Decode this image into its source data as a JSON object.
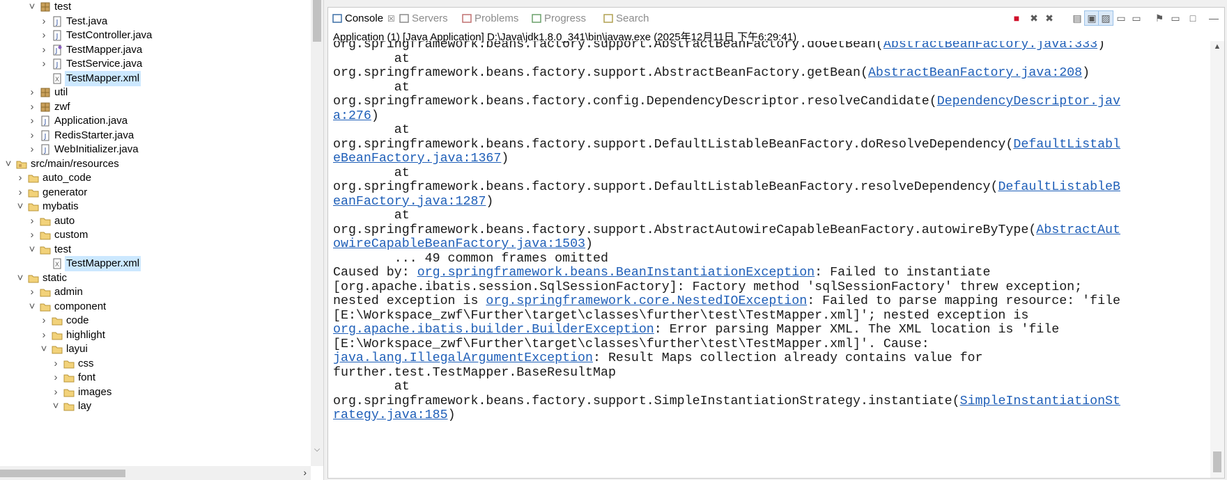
{
  "explorer": {
    "rows": [
      {
        "label": "test",
        "indent": 2,
        "chevron": "expanded",
        "icon": "package-icon"
      },
      {
        "label": "Test.java",
        "indent": 3,
        "chevron": "collapsed",
        "icon": "java-file-icon"
      },
      {
        "label": "TestController.java",
        "indent": 3,
        "chevron": "collapsed",
        "icon": "java-file-icon"
      },
      {
        "label": "TestMapper.java",
        "indent": 3,
        "chevron": "collapsed",
        "icon": "java-interface-file-icon"
      },
      {
        "label": "TestService.java",
        "indent": 3,
        "chevron": "collapsed",
        "icon": "java-file-icon"
      },
      {
        "label": "TestMapper.xml",
        "indent": 3,
        "chevron": "none",
        "icon": "xml-file-icon",
        "selected": true
      },
      {
        "label": "util",
        "indent": 2,
        "chevron": "collapsed",
        "icon": "package-icon"
      },
      {
        "label": "zwf",
        "indent": 2,
        "chevron": "collapsed",
        "icon": "package-icon"
      },
      {
        "label": "Application.java",
        "indent": 2,
        "chevron": "collapsed",
        "icon": "java-file-icon"
      },
      {
        "label": "RedisStarter.java",
        "indent": 2,
        "chevron": "collapsed",
        "icon": "java-file-icon"
      },
      {
        "label": "WebInitializer.java",
        "indent": 2,
        "chevron": "collapsed",
        "icon": "java-file-icon"
      },
      {
        "label": "src/main/resources",
        "indent": 0,
        "chevron": "expanded",
        "icon": "source-folder-icon"
      },
      {
        "label": "auto_code",
        "indent": 1,
        "chevron": "collapsed",
        "icon": "folder-icon"
      },
      {
        "label": "generator",
        "indent": 1,
        "chevron": "collapsed",
        "icon": "folder-icon"
      },
      {
        "label": "mybatis",
        "indent": 1,
        "chevron": "expanded",
        "icon": "folder-icon"
      },
      {
        "label": "auto",
        "indent": 2,
        "chevron": "collapsed",
        "icon": "folder-icon"
      },
      {
        "label": "custom",
        "indent": 2,
        "chevron": "collapsed",
        "icon": "folder-icon"
      },
      {
        "label": "test",
        "indent": 2,
        "chevron": "expanded",
        "icon": "folder-icon"
      },
      {
        "label": "TestMapper.xml",
        "indent": 3,
        "chevron": "none",
        "icon": "xml-file-icon",
        "selected": true
      },
      {
        "label": "static",
        "indent": 1,
        "chevron": "expanded",
        "icon": "folder-icon"
      },
      {
        "label": "admin",
        "indent": 2,
        "chevron": "collapsed",
        "icon": "folder-icon"
      },
      {
        "label": "component",
        "indent": 2,
        "chevron": "expanded",
        "icon": "folder-icon"
      },
      {
        "label": "code",
        "indent": 3,
        "chevron": "collapsed",
        "icon": "folder-icon"
      },
      {
        "label": "highlight",
        "indent": 3,
        "chevron": "collapsed",
        "icon": "folder-icon"
      },
      {
        "label": "layui",
        "indent": 3,
        "chevron": "expanded",
        "icon": "folder-icon"
      },
      {
        "label": "css",
        "indent": 4,
        "chevron": "collapsed",
        "icon": "folder-icon"
      },
      {
        "label": "font",
        "indent": 4,
        "chevron": "collapsed",
        "icon": "folder-icon"
      },
      {
        "label": "images",
        "indent": 4,
        "chevron": "collapsed",
        "icon": "folder-icon"
      },
      {
        "label": "lay",
        "indent": 4,
        "chevron": "expanded",
        "icon": "folder-icon"
      }
    ]
  },
  "console": {
    "tabs": [
      {
        "label": "Console",
        "icon": "console-icon",
        "active": true
      },
      {
        "label": "Servers",
        "icon": "servers-icon",
        "active": false
      },
      {
        "label": "Problems",
        "icon": "problems-icon",
        "active": false
      },
      {
        "label": "Progress",
        "icon": "progress-icon",
        "active": false
      },
      {
        "label": "Search",
        "icon": "search-icon",
        "active": false
      }
    ],
    "toolbar": [
      "terminate-icon",
      "remove-launch-icon",
      "remove-all-launches-icon",
      "clear-console-icon",
      "scroll-lock-icon",
      "word-wrap-icon",
      "show-on-stdout-icon",
      "show-on-stderr-icon",
      "pin-console-icon",
      "display-console-icon",
      "open-console-icon",
      "minimize-icon",
      "maximize-icon"
    ],
    "launch_info": "Application (1) [Java Application] D:\\Java\\jdk1.8.0_341\\bin\\javaw.exe (2025年12月11日 下午6:29:41)",
    "lines": [
      [
        {
          "t": "org.springframework.beans.factory.support.AbstractBeanFactory.doGetBean("
        },
        {
          "t": "AbstractBeanFactory.java:333",
          "link": true
        },
        {
          "t": ")"
        }
      ],
      [
        {
          "t": "        at"
        }
      ],
      [
        {
          "t": "org.springframework.beans.factory.support.AbstractBeanFactory.getBean("
        },
        {
          "t": "AbstractBeanFactory.java:208",
          "link": true
        },
        {
          "t": ")"
        }
      ],
      [
        {
          "t": "        at"
        }
      ],
      [
        {
          "t": "org.springframework.beans.factory.config.DependencyDescriptor.resolveCandidate("
        },
        {
          "t": "DependencyDescriptor.jav",
          "link": true
        }
      ],
      [
        {
          "t": "a:276",
          "link": true
        },
        {
          "t": ")"
        }
      ],
      [
        {
          "t": "        at"
        }
      ],
      [
        {
          "t": "org.springframework.beans.factory.support.DefaultListableBeanFactory.doResolveDependency("
        },
        {
          "t": "DefaultListabl",
          "link": true
        }
      ],
      [
        {
          "t": "eBeanFactory.java:1367",
          "link": true
        },
        {
          "t": ")"
        }
      ],
      [
        {
          "t": "        at"
        }
      ],
      [
        {
          "t": "org.springframework.beans.factory.support.DefaultListableBeanFactory.resolveDependency("
        },
        {
          "t": "DefaultListableB",
          "link": true
        }
      ],
      [
        {
          "t": "eanFactory.java:1287",
          "link": true
        },
        {
          "t": ")"
        }
      ],
      [
        {
          "t": "        at"
        }
      ],
      [
        {
          "t": "org.springframework.beans.factory.support.AbstractAutowireCapableBeanFactory.autowireByType("
        },
        {
          "t": "AbstractAut",
          "link": true
        }
      ],
      [
        {
          "t": "owireCapableBeanFactory.java:1503",
          "link": true
        },
        {
          "t": ")"
        }
      ],
      [
        {
          "t": "        ... 49 common frames omitted"
        }
      ],
      [
        {
          "t": "Caused by: "
        },
        {
          "t": "org.springframework.beans.BeanInstantiationException",
          "link": true
        },
        {
          "t": ": Failed to instantiate"
        }
      ],
      [
        {
          "t": "[org.apache.ibatis.session.SqlSessionFactory]: Factory method 'sqlSessionFactory' threw exception;"
        }
      ],
      [
        {
          "t": "nested exception is "
        },
        {
          "t": "org.springframework.core.NestedIOException",
          "link": true
        },
        {
          "t": ": Failed to parse mapping resource: 'file"
        }
      ],
      [
        {
          "t": "[E:\\Workspace_zwf\\Further\\target\\classes\\further\\test\\TestMapper.xml]'; nested exception is"
        }
      ],
      [
        {
          "t": "org.apache.ibatis.builder.BuilderException",
          "link": true
        },
        {
          "t": ": Error parsing Mapper XML. The XML location is 'file"
        }
      ],
      [
        {
          "t": "[E:\\Workspace_zwf\\Further\\target\\classes\\further\\test\\TestMapper.xml]'. Cause:"
        }
      ],
      [
        {
          "t": "java.lang.IllegalArgumentException",
          "link": true
        },
        {
          "t": ": Result Maps collection already contains value for"
        }
      ],
      [
        {
          "t": "further.test.TestMapper.BaseResultMap"
        }
      ],
      [
        {
          "t": "        at"
        }
      ],
      [
        {
          "t": "org.springframework.beans.factory.support.SimpleInstantiationStrategy.instantiate("
        },
        {
          "t": "SimpleInstantiationSt",
          "link": true
        }
      ],
      [
        {
          "t": "rategy.java:185",
          "link": true
        },
        {
          "t": ")"
        }
      ]
    ]
  }
}
